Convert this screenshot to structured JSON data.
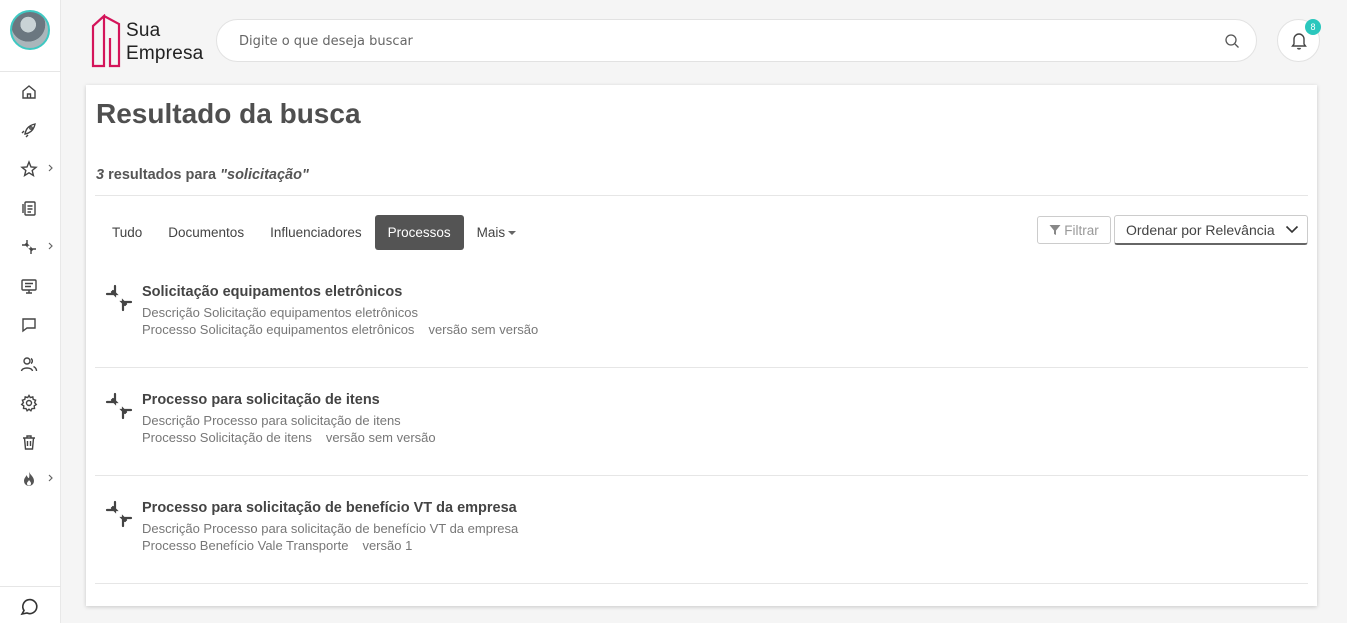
{
  "header": {
    "logo_line1": "Sua",
    "logo_line2": "Empresa",
    "search_placeholder": "Digite o que deseja buscar",
    "notification_count": "8"
  },
  "sidebar": {
    "items": [
      {
        "name": "home",
        "icon": "home-icon",
        "has_submenu": false
      },
      {
        "name": "rocket",
        "icon": "rocket-icon",
        "has_submenu": false
      },
      {
        "name": "favorites",
        "icon": "star-icon",
        "has_submenu": true
      },
      {
        "name": "documents",
        "icon": "documents-icon",
        "has_submenu": false
      },
      {
        "name": "processes",
        "icon": "process-icon",
        "has_submenu": true
      },
      {
        "name": "presentation",
        "icon": "monitor-icon",
        "has_submenu": false
      },
      {
        "name": "chat",
        "icon": "message-icon",
        "has_submenu": false
      },
      {
        "name": "users",
        "icon": "users-icon",
        "has_submenu": false
      },
      {
        "name": "settings",
        "icon": "gear-icon",
        "has_submenu": false
      },
      {
        "name": "trash",
        "icon": "trash-icon",
        "has_submenu": false
      },
      {
        "name": "fire",
        "icon": "fire-icon",
        "has_submenu": true
      }
    ]
  },
  "main": {
    "title": "Resultado da busca",
    "count_number": "3",
    "count_text": " resultados para ",
    "query": "\"solicitação\"",
    "tabs": [
      {
        "label": "Tudo",
        "active": false
      },
      {
        "label": "Documentos",
        "active": false
      },
      {
        "label": "Influenciadores",
        "active": false
      },
      {
        "label": "Processos",
        "active": true
      },
      {
        "label": "Mais",
        "active": false
      }
    ],
    "filter_label": "Filtrar",
    "sort_label": "Ordenar por Relevância",
    "results": [
      {
        "title": "Solicitação equipamentos eletrônicos",
        "description": "Descrição Solicitação equipamentos eletrônicos",
        "process": "Processo Solicitação equipamentos eletrônicos",
        "version": "versão sem versão"
      },
      {
        "title": "Processo para solicitação de itens",
        "description": "Descrição Processo para solicitação de itens",
        "process": "Processo Solicitação de itens",
        "version": "versão sem versão"
      },
      {
        "title": "Processo para solicitação de benefício VT da empresa",
        "description": "Descrição Processo para solicitação de benefício VT da empresa",
        "process": "Processo Benefício Vale Transporte",
        "version": "versão 1"
      }
    ]
  },
  "colors": {
    "accent": "#2bc7bd",
    "brand": "#d4145a",
    "active_tab": "#545454"
  }
}
